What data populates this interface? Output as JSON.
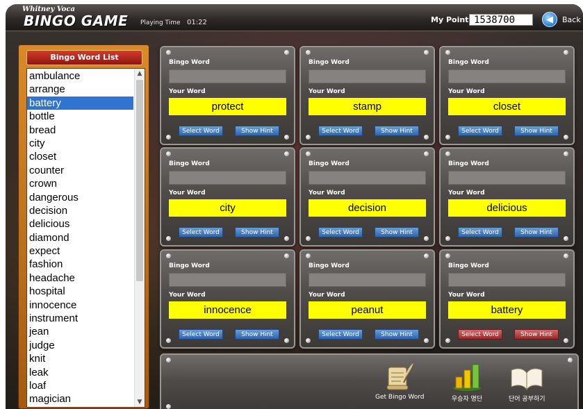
{
  "header": {
    "brand_small": "Whitney Voca",
    "brand_big": "BINGO GAME",
    "playing_time_label": "Playing Time",
    "playing_time_value": "01:22",
    "my_point_label": "My Point",
    "my_point_value": "1538700",
    "back_label": "Back",
    "back_icon": "back-arrow-icon"
  },
  "word_list": {
    "title": "Bingo Word List",
    "selected": "battery",
    "items": [
      "ambulance",
      "arrange",
      "battery",
      "bottle",
      "bread",
      "city",
      "closet",
      "counter",
      "crown",
      "dangerous",
      "decision",
      "delicious",
      "diamond",
      "expect",
      "fashion",
      "headache",
      "hospital",
      "innocence",
      "instrument",
      "jean",
      "judge",
      "knit",
      "leak",
      "loaf",
      "magician"
    ]
  },
  "cards": [
    {
      "bingo_word_label": "Bingo Word",
      "bingo_word": "",
      "your_word_label": "Your Word",
      "your_word": "protect",
      "select_label": "Select Word",
      "hint_label": "Show Hint",
      "theme": "blue"
    },
    {
      "bingo_word_label": "Bingo Word",
      "bingo_word": "",
      "your_word_label": "Your Word",
      "your_word": "stamp",
      "select_label": "Select Word",
      "hint_label": "Show Hint",
      "theme": "blue"
    },
    {
      "bingo_word_label": "Bingo Word",
      "bingo_word": "",
      "your_word_label": "Your Word",
      "your_word": "closet",
      "select_label": "Select Word",
      "hint_label": "Show Hint",
      "theme": "blue"
    },
    {
      "bingo_word_label": "Bingo Word",
      "bingo_word": "",
      "your_word_label": "Your Word",
      "your_word": "city",
      "select_label": "Select Word",
      "hint_label": "Show Hint",
      "theme": "blue"
    },
    {
      "bingo_word_label": "Bingo Word",
      "bingo_word": "",
      "your_word_label": "Your Word",
      "your_word": "decision",
      "select_label": "Select Word",
      "hint_label": "Show Hint",
      "theme": "blue"
    },
    {
      "bingo_word_label": "Bingo Word",
      "bingo_word": "",
      "your_word_label": "Your Word",
      "your_word": "delicious",
      "select_label": "Select Word",
      "hint_label": "Show Hint",
      "theme": "blue"
    },
    {
      "bingo_word_label": "Bingo Word",
      "bingo_word": "",
      "your_word_label": "Your Word",
      "your_word": "innocence",
      "select_label": "Select Word",
      "hint_label": "Show Hint",
      "theme": "blue"
    },
    {
      "bingo_word_label": "Bingo Word",
      "bingo_word": "",
      "your_word_label": "Your Word",
      "your_word": "peanut",
      "select_label": "Select Word",
      "hint_label": "Show Hint",
      "theme": "blue"
    },
    {
      "bingo_word_label": "Bingo Word",
      "bingo_word": "",
      "your_word_label": "Your Word",
      "your_word": "battery",
      "select_label": "Select Word",
      "hint_label": "Show Hint",
      "theme": "red"
    }
  ],
  "actions": [
    {
      "label": "Get Bingo Word",
      "icon": "scroll-quill-icon"
    },
    {
      "label": "우승자 명단",
      "icon": "bar-chart-icon"
    },
    {
      "label": "단어 공부하기",
      "icon": "open-book-icon"
    }
  ],
  "colors": {
    "your_word_bg": "#ffff00",
    "button_blue": "#3a6fb8",
    "button_red": "#b03a3a",
    "list_selected": "#2f74d0",
    "word_list_title": "#b8271a"
  }
}
